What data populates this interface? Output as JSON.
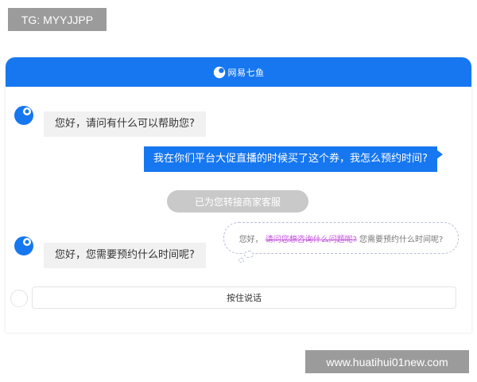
{
  "watermark_top": "TG: MYYJJPP",
  "watermark_bottom": "www.huatihui01new.com",
  "header": {
    "title": "网易七鱼"
  },
  "messages": {
    "greeting": "您好，请问有什么可以帮助您?",
    "user_question": "我在你们平台大促直播的时候买了这个券，我怎么预约时间?",
    "system_notice": "已为您转接商家客服",
    "agent_reply": "您好，您需要预约什么时间呢?"
  },
  "thought": {
    "prefix": "您好，",
    "struck": "请问您想咨询什么问题呢?",
    "suggestion": "您需要预约什么时间呢?"
  },
  "input": {
    "voice_label": "按住说话"
  },
  "colors": {
    "brand": "#1677f0",
    "bubble_gray": "#f1f1f1",
    "pill_gray": "#c9c9c9",
    "strike_purple": "#c44ee0"
  },
  "icons": {
    "avatar": "qiyu-logo-icon",
    "mic": "mic-toggle-icon"
  }
}
